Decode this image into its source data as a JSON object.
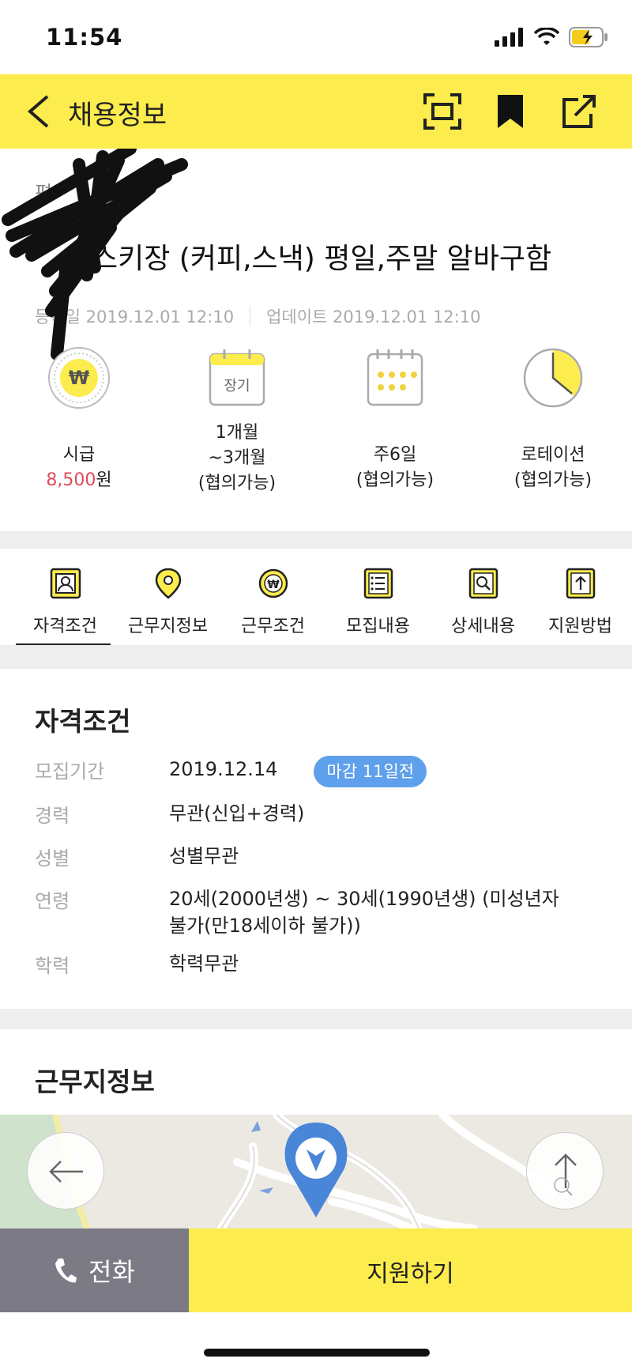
{
  "status": {
    "time": "11:54"
  },
  "header": {
    "title": "채용정보"
  },
  "job": {
    "company": "편",
    "title": "스키장 (커피,스낵) 평일,주말 알바구함",
    "registered": "등록일 2019.12.01 12:10",
    "updated": "업데이트 2019.12.01 12:10"
  },
  "summary": {
    "wage_label": "시급",
    "wage_amount": "8,500",
    "wage_unit": "원",
    "period_badge": "장기",
    "period_line1": "1개월",
    "period_line2": "~3개월",
    "period_line3": "(협의가능)",
    "days_line1": "주6일",
    "days_line2": "(협의가능)",
    "time_line1": "로테이션",
    "time_line2": "(협의가능)"
  },
  "tabs": [
    {
      "label": "자격조건"
    },
    {
      "label": "근무지정보"
    },
    {
      "label": "근무조건"
    },
    {
      "label": "모집내용"
    },
    {
      "label": "상세내용"
    },
    {
      "label": "지원방법"
    }
  ],
  "qualification": {
    "title": "자격조건",
    "rows": [
      {
        "label": "모집기간",
        "value": "2019.12.14",
        "badge": "마감 11일전"
      },
      {
        "label": "경력",
        "value": "무관(신입+경력)"
      },
      {
        "label": "성별",
        "value": "성별무관"
      },
      {
        "label": "연령",
        "value": "20세(2000년생) ~ 30세(1990년생) (미성년자 불가(만18세이하 불가))"
      },
      {
        "label": "학력",
        "value": "학력무관"
      }
    ]
  },
  "workplace": {
    "title": "근무지정보"
  },
  "bottom": {
    "call": "전화",
    "apply": "지원하기"
  },
  "colors": {
    "brand_yellow": "#fcec4d",
    "accent_red": "#e04b5a",
    "badge_blue": "#5ea0ec",
    "call_gray": "#7b7a85"
  }
}
